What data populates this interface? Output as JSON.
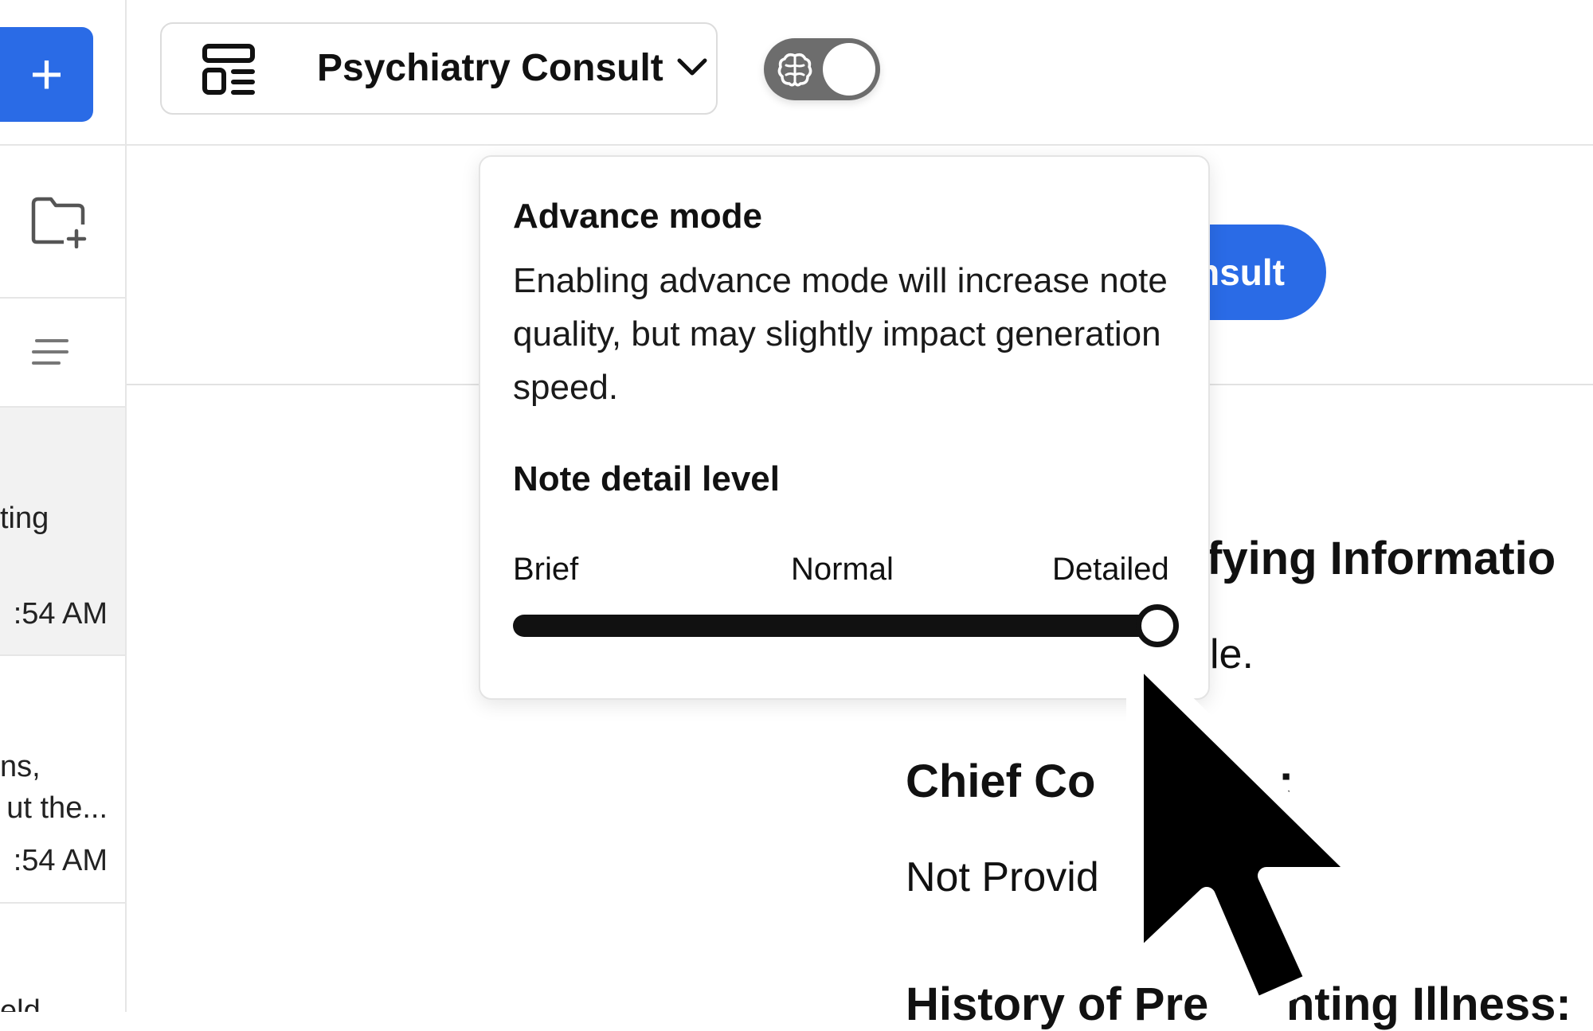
{
  "sidebar": {
    "new_button_icon": "plus-icon",
    "folder_icon": "folder-plus-icon",
    "menu_icon": "menu-lines-icon",
    "items": [
      {
        "line1": "ting",
        "time": ":54 AM"
      },
      {
        "line1": "ns,",
        "line2": "ut the...",
        "time": ":54 AM"
      },
      {
        "line1": "eld"
      }
    ]
  },
  "header": {
    "template_icon": "template-layout-icon",
    "template_label": "Psychiatry Consult",
    "dropdown_icon": "chevron-down-icon",
    "toggle_icon": "brain-icon",
    "toggle_on": true
  },
  "main": {
    "consult_button": "nsult",
    "sections": {
      "identifying_heading": "fying Informatio",
      "identifying_text": "le.",
      "chief_heading": "Chief Co",
      "chief_heading_tail": ":",
      "chief_text": "Not Provid",
      "history_heading": "History of Pre",
      "history_heading_tail": "nting Illness:"
    }
  },
  "popover": {
    "title": "Advance mode",
    "description": "Enabling advance mode will increase note quality, but may slightly impact generation speed.",
    "detail_title": "Note detail level",
    "levels": [
      "Brief",
      "Normal",
      "Detailed"
    ],
    "selected_level": "Detailed",
    "slider_value": 1.0
  },
  "colors": {
    "accent": "#2a6be6",
    "toggle_bg": "#6d6d6d",
    "border": "#e4e4e4"
  }
}
